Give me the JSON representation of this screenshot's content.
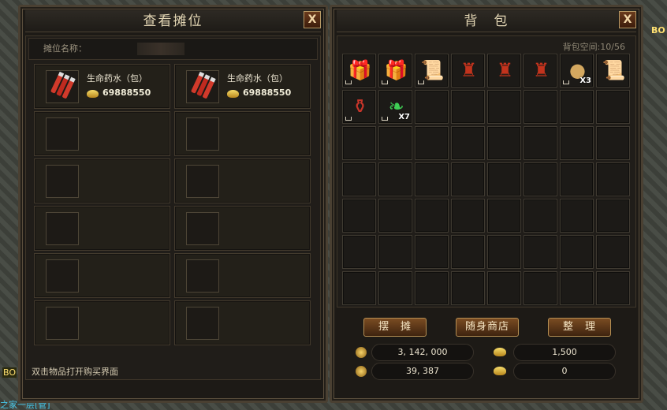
{
  "stall_panel": {
    "title": "查看摊位",
    "close": "X",
    "name_label": "摊位名称：",
    "items": [
      {
        "name": "生命药水（包）",
        "price": "69888550"
      },
      {
        "name": "生命药水（包）",
        "price": "69888550"
      }
    ],
    "footer": "双击物品打开购买界面"
  },
  "bag_panel": {
    "title": "背　包",
    "close": "X",
    "space": "背包空间:10/56",
    "items": [
      {
        "icon": "gift-box-icon",
        "glyph": "🎁",
        "color": "#b070d0",
        "lock": true
      },
      {
        "icon": "gift-box-icon",
        "glyph": "🎁",
        "color": "#4c8ee0",
        "lock": true
      },
      {
        "icon": "scroll-icon",
        "glyph": "📜",
        "color": "#9bb0c8",
        "lock": true
      },
      {
        "icon": "armor-icon",
        "glyph": "♜",
        "color": "#c2331d",
        "lock": false
      },
      {
        "icon": "armor-icon",
        "glyph": "♜",
        "color": "#c2331d",
        "lock": false
      },
      {
        "icon": "armor-icon",
        "glyph": "♜",
        "color": "#c2331d",
        "lock": false
      },
      {
        "icon": "stone-icon",
        "glyph": "●",
        "color": "#d4a860",
        "lock": true,
        "qty": "X3"
      },
      {
        "icon": "purple-scroll-icon",
        "glyph": "📜",
        "color": "#9d4bd8",
        "lock": false
      },
      {
        "icon": "potion-icon",
        "glyph": "⚱",
        "color": "#c8352a",
        "lock": true
      },
      {
        "icon": "jade-icon",
        "glyph": "❧",
        "color": "#3fcf55",
        "lock": true,
        "qty": "X7"
      }
    ],
    "buttons": {
      "stall": "摆　摊",
      "shop": "随身商店",
      "sort": "整　理"
    },
    "money": {
      "gold": "3, 142, 000",
      "ingot": "1,500",
      "bound_gold": "39, 387",
      "bound_ingot": "0"
    }
  },
  "background": {
    "tag_left": "BO",
    "tag_right": "BO",
    "bottom_text": "之家一层[管]"
  }
}
